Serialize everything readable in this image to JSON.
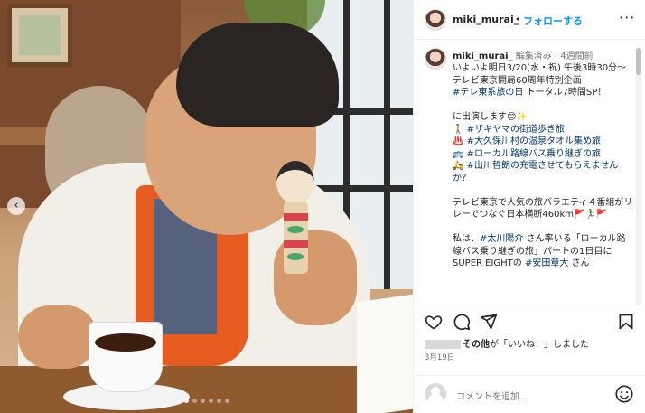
{
  "photo": {
    "prev_glyph": "‹",
    "carousel_dots": [
      true,
      false,
      false,
      false,
      false,
      false
    ]
  },
  "header": {
    "username": "miki_murai_",
    "separator": "•",
    "follow_label": "フォローする",
    "more_glyph": "···"
  },
  "caption": {
    "username": "miki_murai_",
    "meta": "編集済み · 4週間前",
    "lines": [
      {
        "t": "いよいよ明日3/20(水・祝) 午後3時30分〜"
      },
      {
        "t": "テレビ東京開局60周年特別企画"
      },
      {
        "t": "#テレ東系旅の日 トータル7時間SP！",
        "tag": "#テレ東系旅の日"
      },
      {
        "t": ""
      },
      {
        "t": "に出演します😊✨"
      },
      {
        "t": "🚶 #ザキヤマの街道歩き旅",
        "tag": "#ザキヤマの街道歩き旅"
      },
      {
        "t": "♨️ #大久保川村の温泉タオル集め旅",
        "tag": "#大久保川村の温泉タオル集め旅"
      },
      {
        "t": "🚌 #ローカル路線バス乗り継ぎの旅",
        "tag": "#ローカル路線バス乗り継ぎの旅"
      },
      {
        "t": "🛵 #出川哲朗の充電させてもらえませんか？",
        "tag": "#出川哲朗の充電させてもらえませんか"
      },
      {
        "t": ""
      },
      {
        "t": "テレビ東京で人気の旅バラエティ４番組がリレーでつなぐ日本横断460km🚩🏃‍♂️🚩"
      },
      {
        "t": ""
      },
      {
        "t": "私は、#太川陽介 さん率いる「ローカル路線バス乗り継ぎの旅」パートの1日目に SUPER EIGHTの #安田章大 さん",
        "tag": "#太川陽介"
      }
    ]
  },
  "actions": {
    "like_icon": "heart-icon",
    "comment_icon": "comment-icon",
    "share_icon": "share-icon",
    "save_icon": "bookmark-icon"
  },
  "likes": {
    "others_text": "その他",
    "suffix_text": "が「いいね！」しました"
  },
  "date": "3月19日",
  "comment": {
    "placeholder": "コメントを追加..."
  },
  "colors": {
    "accent": "#0095f6",
    "hashtag": "#00376b",
    "muted": "#737373"
  }
}
